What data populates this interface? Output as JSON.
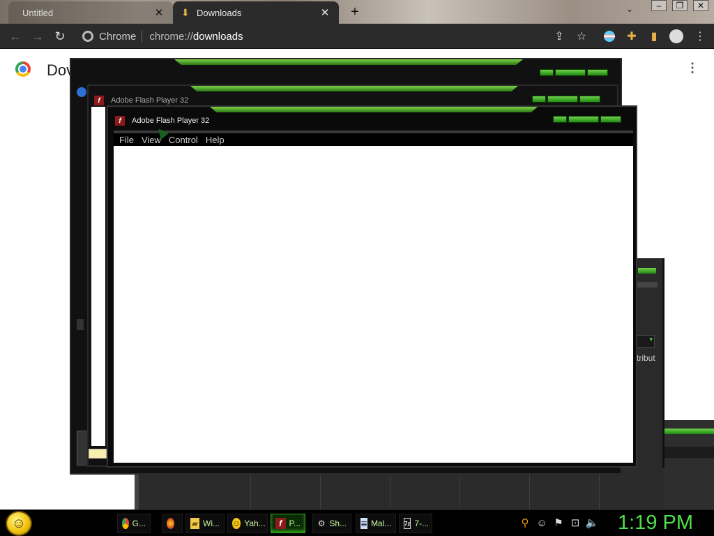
{
  "browser": {
    "tabs": [
      {
        "title": "Untitled",
        "active": false
      },
      {
        "title": "Downloads",
        "active": true
      }
    ],
    "new_tab_label": "+",
    "omnibox": {
      "origin": "Chrome",
      "url_prefix": "chrome://",
      "url_path": "downloads"
    }
  },
  "page": {
    "title": "Dov"
  },
  "windows": [
    {
      "title": "Adobe Flash Player 32"
    }
  ],
  "flash_window": {
    "title": "Adobe Flash Player 32",
    "menu": [
      "File",
      "View",
      "Control",
      "Help"
    ]
  },
  "background_window": {
    "partial_label": "tribut"
  },
  "taskbar": {
    "items": [
      {
        "label": "G...",
        "icon": "chrome-icon"
      },
      {
        "label": "",
        "icon": "firefox-icon"
      },
      {
        "label": "Wi...",
        "icon": "folder-icon"
      },
      {
        "label": "Yah...",
        "icon": "yahoo-messenger-icon"
      },
      {
        "label": "P...",
        "icon": "flash-player-icon",
        "active": true
      },
      {
        "label": "Sh...",
        "icon": "settings-icon"
      },
      {
        "label": "Mal...",
        "icon": "notepad-icon"
      },
      {
        "label": "7-...",
        "icon": "7zip-icon"
      }
    ],
    "clock": "1:19 PM"
  },
  "colors": {
    "accent_green": "#4ee04a",
    "flash_red": "#8c1a1a",
    "dark_chrome": "#2b2b2b"
  }
}
